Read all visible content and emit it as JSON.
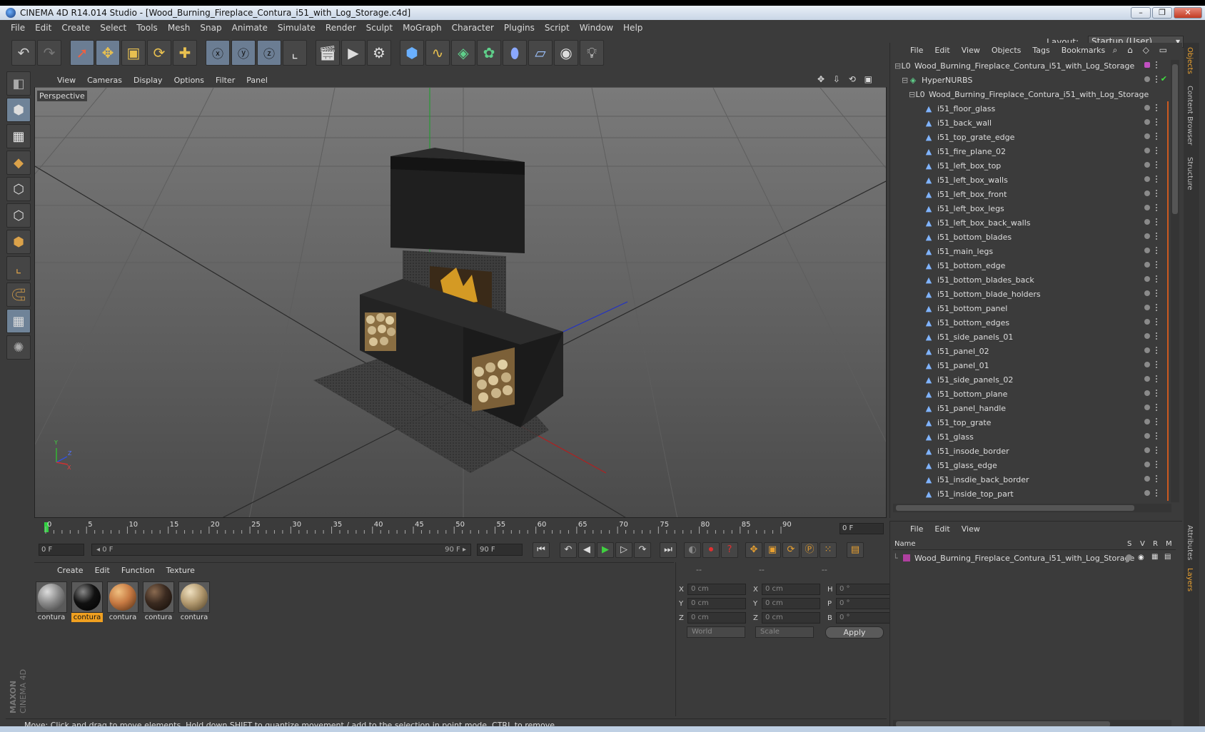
{
  "window": {
    "title": "CINEMA 4D R14.014 Studio - [Wood_Burning_Fireplace_Contura_i51_with_Log_Storage.c4d]",
    "minimize": "–",
    "maximize": "❐",
    "close": "✕"
  },
  "menubar": [
    "File",
    "Edit",
    "Create",
    "Select",
    "Tools",
    "Mesh",
    "Snap",
    "Animate",
    "Simulate",
    "Render",
    "Sculpt",
    "MoGraph",
    "Character",
    "Plugins",
    "Script",
    "Window",
    "Help"
  ],
  "layout": {
    "label": "Layout:",
    "value": "Startup (User)"
  },
  "viewport": {
    "menu": [
      "View",
      "Cameras",
      "Display",
      "Options",
      "Filter",
      "Panel"
    ],
    "camera": "Perspective",
    "icons": "✥ ⇩ ⟲ ▣",
    "axes": {
      "y": "Y",
      "z": "Z",
      "x": "X"
    }
  },
  "timeline": {
    "ticks": [
      "0",
      "5",
      "10",
      "15",
      "20",
      "25",
      "30",
      "35",
      "40",
      "45",
      "50",
      "55",
      "60",
      "65",
      "70",
      "75",
      "80",
      "85",
      "90"
    ],
    "current_frame": "0 F"
  },
  "transport": {
    "start": "0 F",
    "slider_left": "◂ 0 F",
    "slider_right": "90 F ▸",
    "end": "90 F"
  },
  "materials": {
    "menu": [
      "Create",
      "Edit",
      "Function",
      "Texture"
    ],
    "items": [
      {
        "label": "contura",
        "color": "#8a8a8a",
        "selected": false
      },
      {
        "label": "contura",
        "color": "#111111",
        "selected": true
      },
      {
        "label": "contura",
        "color": "#c77a43",
        "selected": false
      },
      {
        "label": "contura",
        "color": "#3a2a20",
        "selected": false
      },
      {
        "label": "contura",
        "color": "#b39a70",
        "selected": false
      }
    ]
  },
  "coordinates": {
    "headers": [
      "--",
      "--",
      "--"
    ],
    "rows": [
      {
        "a": "X",
        "av": "0 cm",
        "b": "X",
        "bv": "0 cm",
        "c": "H",
        "cv": "0 °"
      },
      {
        "a": "Y",
        "av": "0 cm",
        "b": "Y",
        "bv": "0 cm",
        "c": "P",
        "cv": "0 °"
      },
      {
        "a": "Z",
        "av": "0 cm",
        "b": "Z",
        "bv": "0 cm",
        "c": "B",
        "cv": "0 °"
      }
    ],
    "mode1": "World",
    "mode2": "Scale",
    "apply": "Apply"
  },
  "status": "Move: Click and drag to move elements. Hold down SHIFT to quantize movement / add to the selection in point mode, CTRL to remove.",
  "logo": {
    "brand": "MAXON",
    "product": "CINEMA 4D"
  },
  "objects": {
    "menu": [
      "File",
      "Edit",
      "View",
      "Objects",
      "Tags",
      "Bookmarks"
    ],
    "icons": "⌕ ⌂ ◇ ▭",
    "root": "Wood_Burning_Fireplace_Contura_i51_with_Log_Storage",
    "hypernurbs": "HyperNURBS",
    "group": "Wood_Burning_Fireplace_Contura_i51_with_Log_Storage",
    "children": [
      "i51_floor_glass",
      "i51_back_wall",
      "i51_top_grate_edge",
      "i51_fire_plane_02",
      "i51_left_box_top",
      "i51_left_box_walls",
      "i51_left_box_front",
      "i51_left_box_legs",
      "i51_left_box_back_walls",
      "i51_bottom_blades",
      "i51_main_legs",
      "i51_bottom_edge",
      "i51_bottom_blades_back",
      "i51_bottom_blade_holders",
      "i51_bottom_panel",
      "i51_bottom_edges",
      "i51_side_panels_01",
      "i51_panel_02",
      "i51_panel_01",
      "i51_side_panels_02",
      "i51_bottom_plane",
      "i51_panel_handle",
      "i51_top_grate",
      "i51_glass",
      "i51_insode_border",
      "i51_glass_edge",
      "i51_insdie_back_border",
      "i51_inside_top_part"
    ]
  },
  "layers": {
    "menu": [
      "File",
      "Edit",
      "View"
    ],
    "columns": {
      "name": "Name",
      "s": "S",
      "v": "V",
      "r": "R",
      "m": "M"
    },
    "items": [
      "Wood_Burning_Fireplace_Contura_i51_with_Log_Storage"
    ]
  },
  "sidetabs": [
    "Objects",
    "Content Browser",
    "Structure",
    "Attributes",
    "Layers"
  ]
}
